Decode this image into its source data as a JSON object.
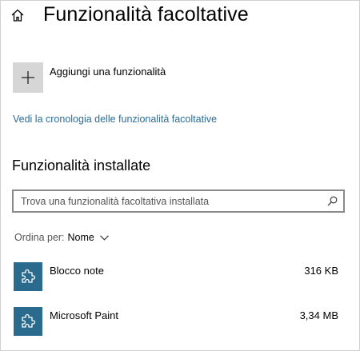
{
  "header": {
    "title": "Funzionalità facoltative",
    "home_icon": "home-icon"
  },
  "add_feature": {
    "label": "Aggiungi una funzionalità",
    "icon": "plus-icon"
  },
  "history_link": {
    "label": "Vedi la cronologia delle funzionalità facoltative"
  },
  "installed": {
    "title": "Funzionalità installate",
    "search": {
      "placeholder": "Trova una funzionalità facoltativa installata",
      "value": "",
      "icon": "search-icon"
    },
    "sort": {
      "label": "Ordina per:",
      "value": "Nome"
    },
    "items": [
      {
        "name": "Blocco note",
        "size": "316 KB",
        "icon": "puzzle-icon"
      },
      {
        "name": "Microsoft Paint",
        "size": "3,34 MB",
        "icon": "puzzle-icon"
      }
    ]
  },
  "colors": {
    "accent": "#2a6a8c",
    "link": "#2a6d96",
    "tile": "#d6d6d6",
    "search_border": "#8a8a8a"
  }
}
